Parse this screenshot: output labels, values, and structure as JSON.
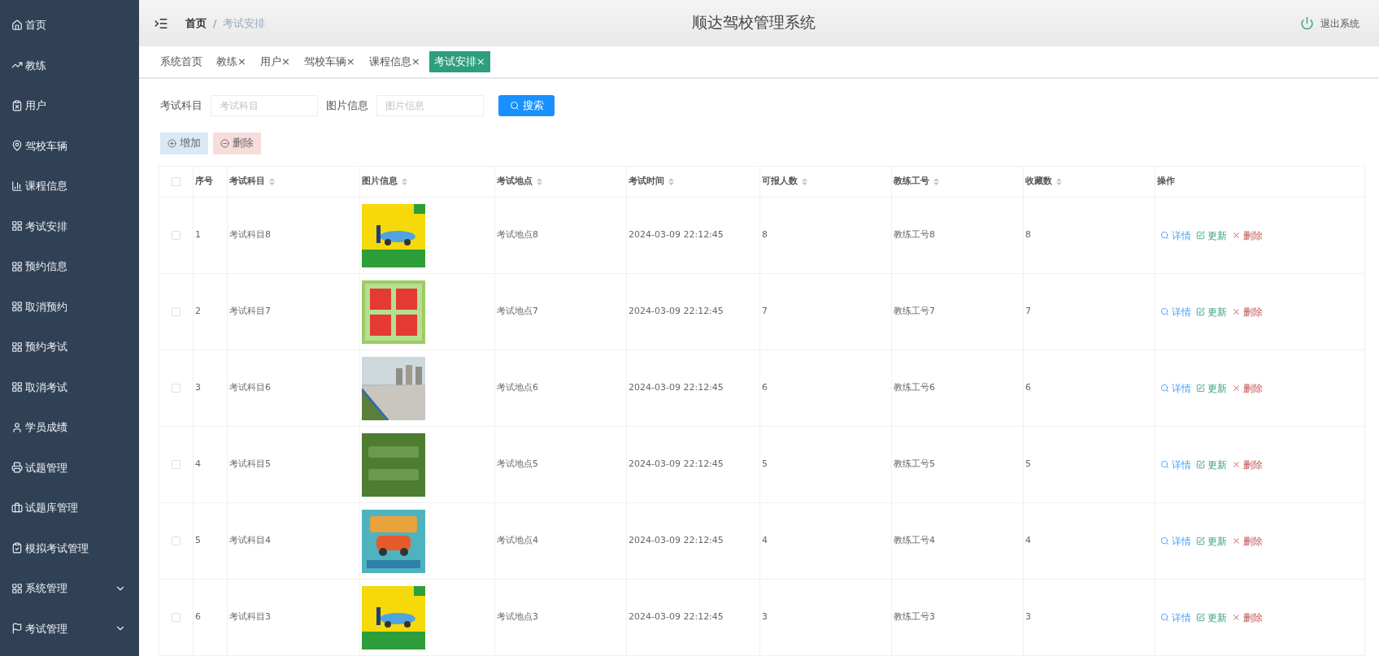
{
  "sidebar": {
    "items": [
      {
        "label": "首页",
        "selected": false
      },
      {
        "label": "教练",
        "selected": false
      },
      {
        "label": "用户",
        "selected": false
      },
      {
        "label": "驾校车辆",
        "selected": false
      },
      {
        "label": "课程信息",
        "selected": false
      },
      {
        "label": "考试安排",
        "selected": false
      },
      {
        "label": "预约信息",
        "selected": false
      },
      {
        "label": "取消预约",
        "selected": false
      },
      {
        "label": "预约考试",
        "selected": false
      },
      {
        "label": "取消考试",
        "selected": false
      },
      {
        "label": "学员成绩",
        "selected": false
      },
      {
        "label": "试题管理",
        "selected": false
      },
      {
        "label": "试题库管理",
        "selected": false
      },
      {
        "label": "模拟考试管理",
        "selected": false
      },
      {
        "label": "系统管理",
        "selected": false,
        "expanded": false
      },
      {
        "label": "考试管理",
        "selected": false,
        "expanded": false
      }
    ]
  },
  "header": {
    "breadcrumb": [
      "首页",
      "考试安排"
    ],
    "separator": "/",
    "title": "顺达驾校管理系统",
    "logout": "退出系统"
  },
  "tabs": [
    {
      "label": "系统首页",
      "selected": false
    },
    {
      "label": "教练",
      "close": "×",
      "selected": false
    },
    {
      "label": "用户",
      "close": "×",
      "selected": false
    },
    {
      "label": "驾校车辆",
      "close": "×",
      "selected": false
    },
    {
      "label": "课程信息",
      "close": "×",
      "selected": false
    },
    {
      "label": "考试安排",
      "close": "×",
      "selected": true
    }
  ],
  "search": {
    "fields": [
      {
        "label": "考试科目",
        "placeholder": "考试科目"
      },
      {
        "label": "图片信息",
        "placeholder": "图片信息"
      }
    ],
    "button": "搜索"
  },
  "actions": {
    "add": "增加",
    "delete": "删除"
  },
  "table": {
    "select_all": {
      "checked": false
    },
    "columns": [
      {
        "label": "序号",
        "sortable": false
      },
      {
        "label": "考试科目",
        "sortable": true
      },
      {
        "label": "图片信息",
        "sortable": true
      },
      {
        "label": "考试地点",
        "sortable": true
      },
      {
        "label": "考试时间",
        "sortable": true
      },
      {
        "label": "可报人数",
        "sortable": true
      },
      {
        "label": "教练工号",
        "sortable": true
      },
      {
        "label": "收藏数",
        "sortable": true
      },
      {
        "label": "操作",
        "sortable": false
      }
    ],
    "rows": [
      {
        "checked": false,
        "index": "1",
        "subject": "考试科目8",
        "place": "考试地点8",
        "time": "2024-03-09 22:12:45",
        "capacity": "8",
        "coach_no": "教练工号8",
        "favorites": "8",
        "actions": [
          "详情",
          "更新",
          "删除"
        ]
      },
      {
        "checked": false,
        "index": "2",
        "subject": "考试科目7",
        "place": "考试地点7",
        "time": "2024-03-09 22:12:45",
        "capacity": "7",
        "coach_no": "教练工号7",
        "favorites": "7",
        "actions": [
          "详情",
          "更新",
          "删除"
        ]
      },
      {
        "checked": false,
        "index": "3",
        "subject": "考试科目6",
        "place": "考试地点6",
        "time": "2024-03-09 22:12:45",
        "capacity": "6",
        "coach_no": "教练工号6",
        "favorites": "6",
        "actions": [
          "详情",
          "更新",
          "删除"
        ]
      },
      {
        "checked": false,
        "index": "4",
        "subject": "考试科目5",
        "place": "考试地点5",
        "time": "2024-03-09 22:12:45",
        "capacity": "5",
        "coach_no": "教练工号5",
        "favorites": "5",
        "actions": [
          "详情",
          "更新",
          "删除"
        ]
      },
      {
        "checked": false,
        "index": "5",
        "subject": "考试科目4",
        "place": "考试地点4",
        "time": "2024-03-09 22:12:45",
        "capacity": "4",
        "coach_no": "教练工号4",
        "favorites": "4",
        "actions": [
          "详情",
          "更新",
          "删除"
        ]
      },
      {
        "checked": false,
        "index": "6",
        "subject": "考试科目3",
        "place": "考试地点3",
        "time": "2024-03-09 22:12:45",
        "capacity": "3",
        "coach_no": "教练工号3",
        "favorites": "3",
        "actions": [
          "详情",
          "更新",
          "删除"
        ]
      }
    ]
  }
}
